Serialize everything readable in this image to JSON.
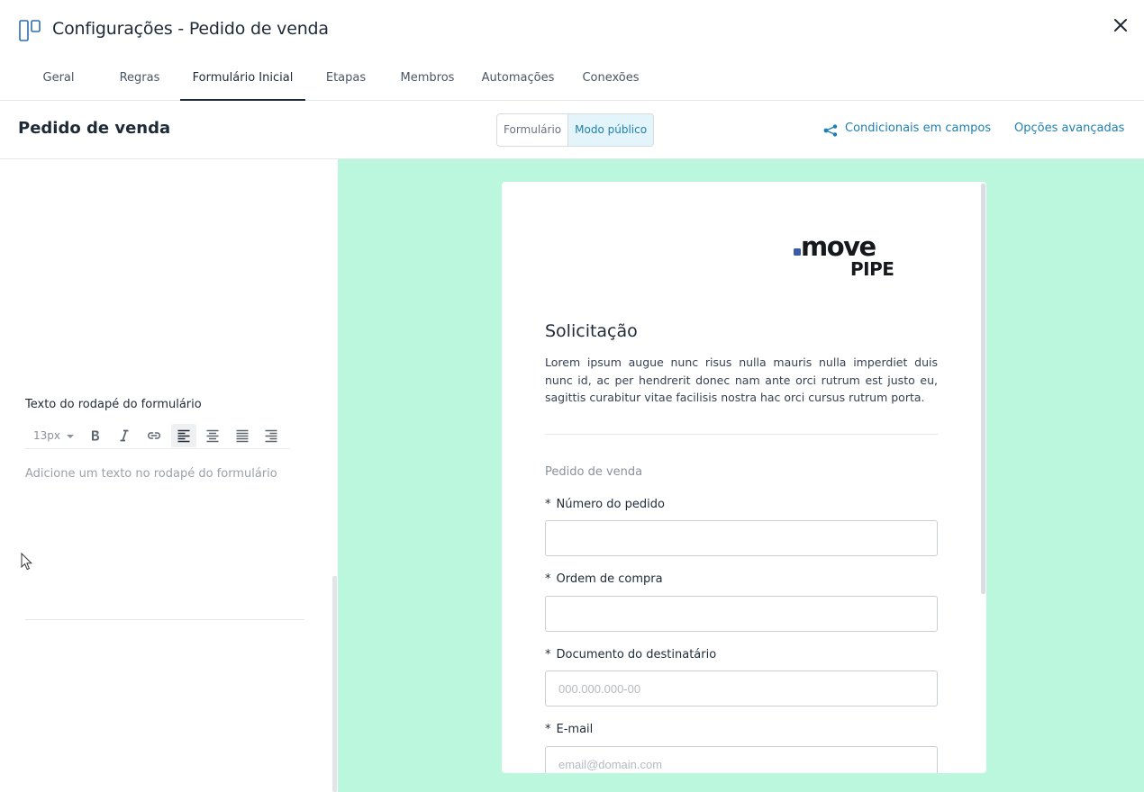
{
  "window": {
    "title": "Configurações - Pedido de venda"
  },
  "tabs": [
    {
      "label": "Geral"
    },
    {
      "label": "Regras"
    },
    {
      "label": "Formulário Inicial"
    },
    {
      "label": "Etapas"
    },
    {
      "label": "Membros"
    },
    {
      "label": "Automações"
    },
    {
      "label": "Conexões"
    }
  ],
  "active_tab": "Formulário Inicial",
  "subheader": {
    "title": "Pedido de venda",
    "segment": [
      {
        "label": "Formulário"
      },
      {
        "label": "Modo público"
      }
    ],
    "active_segment": "Modo público",
    "conditional_link": "Condicionais em campos",
    "advanced_link": "Opções avançadas"
  },
  "left_panel": {
    "footer_label": "Texto do rodapé do formulário",
    "font_size": "13px",
    "editor_placeholder": "Adicione um texto no rodapé do formulário"
  },
  "form": {
    "logo_text_top": "move",
    "logo_text_bottom": "PIPE",
    "title": "Solicitação",
    "description": "Lorem ipsum augue nunc risus nulla mauris nulla imperdiet duis nunc id, ac per hendrerit donec nam ante orci rutrum est justo eu, sagittis curabitur vitae facilisis nostra hac orci cursus rutrum porta.",
    "section_title": "Pedido de venda",
    "fields": [
      {
        "required": "*",
        "label": "Número do pedido",
        "placeholder": ""
      },
      {
        "required": "*",
        "label": "Ordem de compra",
        "placeholder": ""
      },
      {
        "required": "*",
        "label": "Documento do destinatário",
        "placeholder": "000.000.000-00"
      },
      {
        "required": "*",
        "label": "E-mail",
        "placeholder": "email@domain.com"
      }
    ]
  },
  "colors": {
    "accent": "#1f7fb0",
    "preview_background": "#bbf7dc",
    "text": "#1f2a37"
  }
}
